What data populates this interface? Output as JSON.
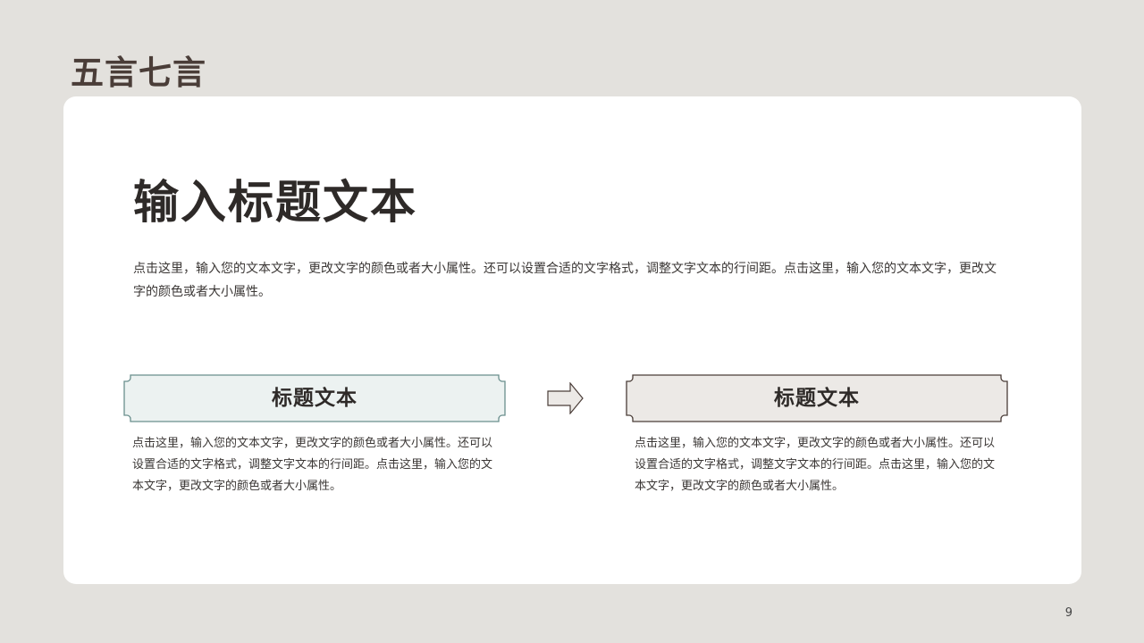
{
  "deck": {
    "section_title": "五言七言",
    "page_number": "9"
  },
  "main": {
    "title": "输入标题文本",
    "description": "点击这里，输入您的文本文字，更改文字的颜色或者大小属性。还可以设置合适的文字格式，调整文字文本的行间距。点击这里，输入您的文本文字，更改文字的颜色或者大小属性。"
  },
  "blocks": [
    {
      "heading": "标题文本",
      "text": "点击这里，输入您的文本文字，更改文字的颜色或者大小属性。还可以设置合适的文字格式，调整文字文本的行间距。点击这里，输入您的文本文字，更改文字的颜色或者大小属性。",
      "fill": "#ecf2f1",
      "stroke": "#6a8f8d"
    },
    {
      "heading": "标题文本",
      "text": "点击这里，输入您的文本文字，更改文字的颜色或者大小属性。还可以设置合适的文字格式，调整文字文本的行间距。点击这里，输入您的文本文字，更改文字的颜色或者大小属性。",
      "fill": "#ece9e6",
      "stroke": "#4a3d38"
    }
  ],
  "icons": {
    "arrow": "arrow-right-icon"
  }
}
